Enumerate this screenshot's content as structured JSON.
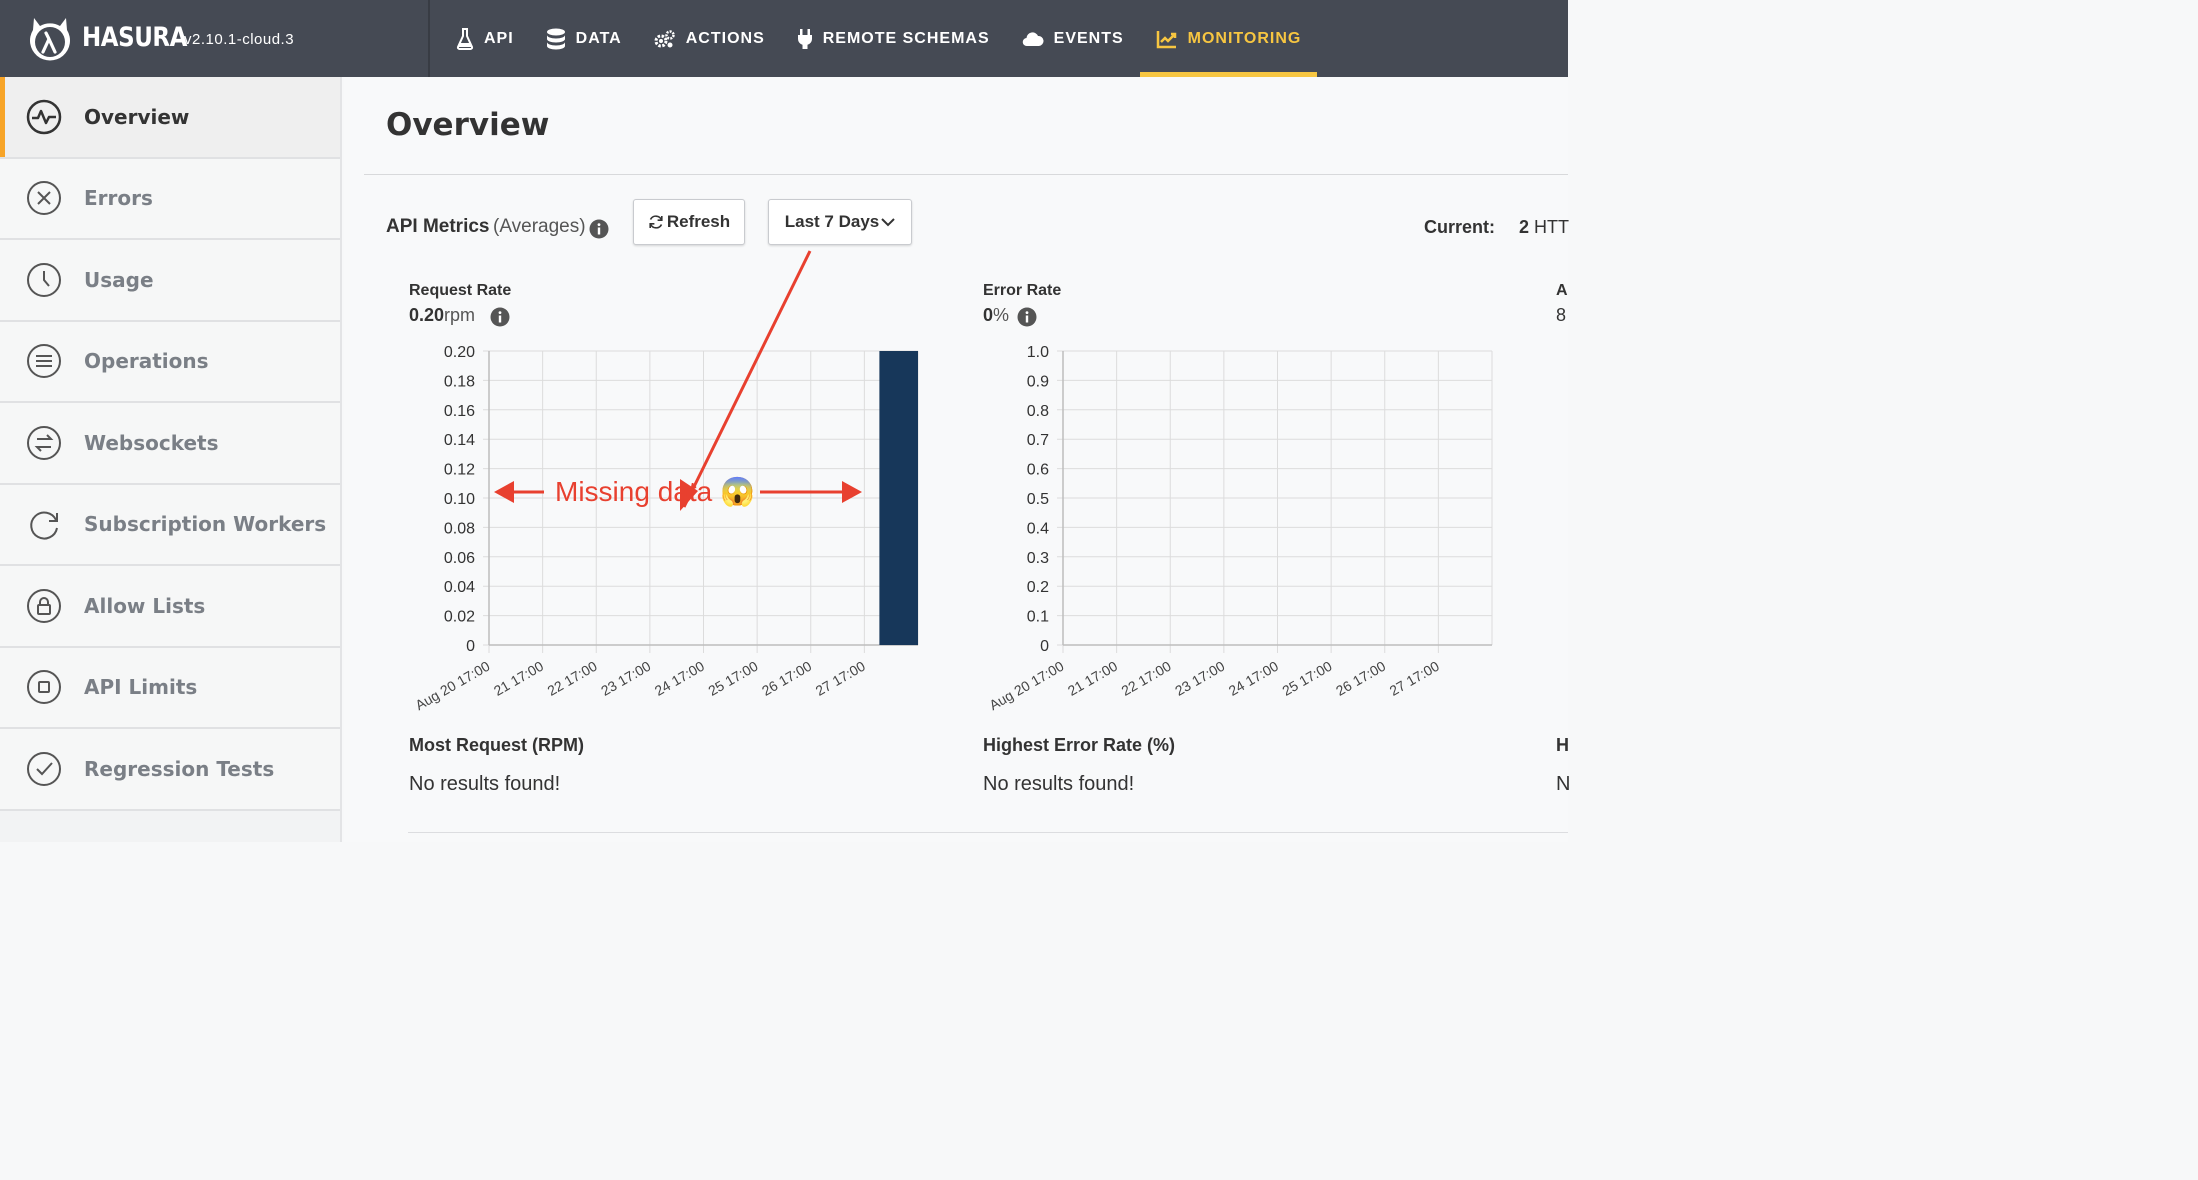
{
  "brand": {
    "name": "HASURA",
    "version": "v2.10.1-cloud.3"
  },
  "nav": [
    {
      "label": "API",
      "icon": "flask-icon",
      "active": false
    },
    {
      "label": "DATA",
      "icon": "database-icon",
      "active": false
    },
    {
      "label": "ACTIONS",
      "icon": "gears-icon",
      "active": false
    },
    {
      "label": "REMOTE SCHEMAS",
      "icon": "plug-icon",
      "active": false
    },
    {
      "label": "EVENTS",
      "icon": "cloud-icon",
      "active": false
    },
    {
      "label": "MONITORING",
      "icon": "chart-line-icon",
      "active": true
    }
  ],
  "sidebar": {
    "items": [
      {
        "label": "Overview",
        "icon": "pulse-icon",
        "active": true
      },
      {
        "label": "Errors",
        "icon": "x-circle-icon",
        "active": false
      },
      {
        "label": "Usage",
        "icon": "clock-icon",
        "active": false
      },
      {
        "label": "Operations",
        "icon": "list-circle-icon",
        "active": false
      },
      {
        "label": "Websockets",
        "icon": "exchange-circle-icon",
        "active": false
      },
      {
        "label": "Subscription Workers",
        "icon": "refresh-circle-icon",
        "active": false
      },
      {
        "label": "Allow Lists",
        "icon": "lock-circle-icon",
        "active": false
      },
      {
        "label": "API Limits",
        "icon": "square-circle-icon",
        "active": false
      },
      {
        "label": "Regression Tests",
        "icon": "check-circle-icon",
        "active": false
      }
    ]
  },
  "main": {
    "title": "Overview",
    "metrics_label": "API Metrics",
    "metrics_sub": "(Averages)",
    "refresh_label": "Refresh",
    "range_label": "Last 7 Days",
    "current_label": "Current:",
    "current_value": "2",
    "current_unit": "HTT"
  },
  "panels": {
    "request": {
      "title": "Request Rate",
      "value": "0.20",
      "unit": "rpm",
      "list_title": "Most Request (RPM)",
      "list_empty": "No results found!"
    },
    "error": {
      "title": "Error Rate",
      "value": "0",
      "unit": "%",
      "list_title": "Highest Error Rate (%)",
      "list_empty": "No results found!"
    },
    "third": {
      "title": "A",
      "value": "8",
      "list_title": "H",
      "list_empty": "N"
    }
  },
  "annotation": {
    "text": "Missing data",
    "emoji": "😱",
    "color": "#e8402f"
  },
  "chart_data": [
    {
      "type": "bar",
      "title": "Request Rate",
      "x": [
        "Aug 20 17:00",
        "21 17:00",
        "22 17:00",
        "23 17:00",
        "24 17:00",
        "25 17:00",
        "26 17:00",
        "27 17:00"
      ],
      "values": [
        0,
        0,
        0,
        0,
        0,
        0,
        0,
        0.2
      ],
      "ylim": [
        0,
        0.2
      ],
      "yticks": [
        "0.20",
        "0.18",
        "0.16",
        "0.14",
        "0.12",
        "0.10",
        "0.08",
        "0.06",
        "0.04",
        "0.02",
        "0"
      ],
      "grid": true,
      "bar_color": "#17375a"
    },
    {
      "type": "bar",
      "title": "Error Rate",
      "x": [
        "Aug 20 17:00",
        "21 17:00",
        "22 17:00",
        "23 17:00",
        "24 17:00",
        "25 17:00",
        "26 17:00",
        "27 17:00"
      ],
      "values": [
        0,
        0,
        0,
        0,
        0,
        0,
        0,
        0
      ],
      "ylim": [
        0,
        1.0
      ],
      "yticks": [
        "1.0",
        "0.9",
        "0.8",
        "0.7",
        "0.6",
        "0.5",
        "0.4",
        "0.3",
        "0.2",
        "0.1",
        "0"
      ],
      "grid": true,
      "bar_color": "#17375a"
    }
  ]
}
